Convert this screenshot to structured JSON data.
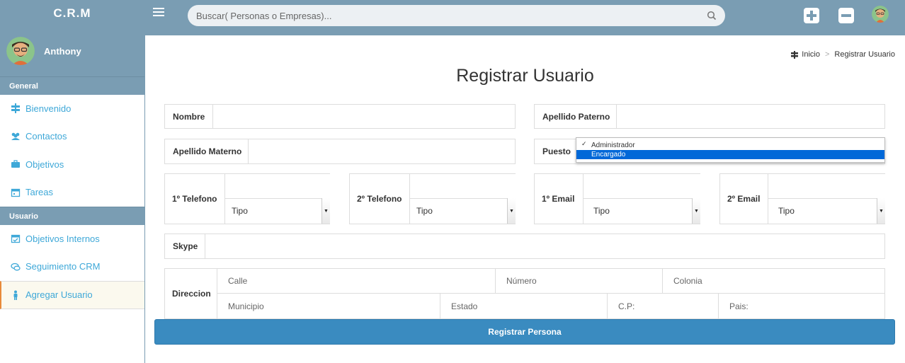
{
  "app": {
    "brand": "C.R.M"
  },
  "search": {
    "placeholder": "Buscar( Personas o Empresas)..."
  },
  "user": {
    "name": "Anthony"
  },
  "sidebar": {
    "sections": [
      {
        "title": "General",
        "items": [
          {
            "label": "Bienvenido",
            "icon": "signpost-icon"
          },
          {
            "label": "Contactos",
            "icon": "users-icon"
          },
          {
            "label": "Objetivos",
            "icon": "briefcase-icon"
          },
          {
            "label": "Tareas",
            "icon": "calendar-icon"
          }
        ]
      },
      {
        "title": "Usuario",
        "items": [
          {
            "label": "Objetivos Internos",
            "icon": "calendar-check-icon"
          },
          {
            "label": "Seguimiento CRM",
            "icon": "chat-icon"
          },
          {
            "label": "Agregar Usuario",
            "icon": "person-icon",
            "active": true
          }
        ]
      }
    ]
  },
  "breadcrumb": {
    "home": "Inicio",
    "sep": ">",
    "current": "Registrar Usuario"
  },
  "page": {
    "title": "Registrar Usuario"
  },
  "form": {
    "nombre_label": "Nombre",
    "apellido_paterno_label": "Apellido Paterno",
    "apellido_materno_label": "Apellido Materno",
    "puesto_label": "Puesto",
    "puesto_options": [
      "Administrador",
      "Encargado"
    ],
    "puesto_checked": "Administrador",
    "puesto_highlighted": "Encargado",
    "tel1_label": "1º Telefono",
    "tel2_label": "2º Telefono",
    "email1_label": "1º Email",
    "email2_label": "2º Email",
    "tipo_label": "Tipo",
    "skype_label": "Skype",
    "direccion_label": "Direccion",
    "calle_placeholder": "Calle",
    "numero_placeholder": "Número",
    "colonia_placeholder": "Colonia",
    "municipio_placeholder": "Municipio",
    "estado_placeholder": "Estado",
    "cp_placeholder": "C.P:",
    "pais_placeholder": "Pais:",
    "submit_label": "Registrar Persona"
  },
  "colors": {
    "topbar": "#7a9db3",
    "link": "#3ea8d8",
    "submit": "#3a8bc0",
    "highlight": "#0068d8"
  }
}
